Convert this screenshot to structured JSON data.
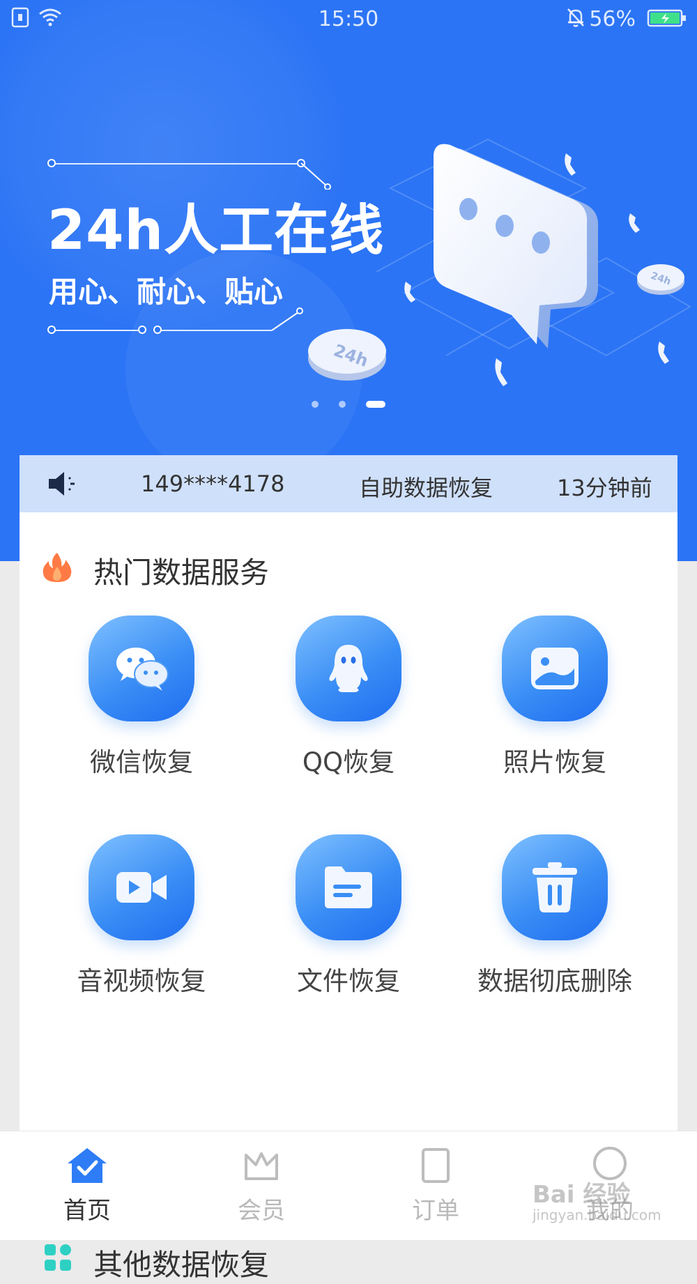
{
  "status_bar": {
    "time": "15:50",
    "battery_percent": "56%",
    "icons": [
      "sim-icon",
      "wifi-icon",
      "bell-off-icon",
      "battery-charging-icon"
    ]
  },
  "banner": {
    "title": "24h人工在线",
    "subtitle": "用心、耐心、贴心",
    "badge_text": "24h",
    "pages": 3,
    "active_page": 3
  },
  "ticker": {
    "phone": "149****4178",
    "action": "自助数据恢复",
    "time_ago": "13分钟前",
    "icon": "speaker-icon"
  },
  "hot_services": {
    "title": "热门数据服务",
    "icon": "flame-icon",
    "items": [
      {
        "label": "微信恢复",
        "icon": "wechat-icon"
      },
      {
        "label": "QQ恢复",
        "icon": "qq-penguin-icon"
      },
      {
        "label": "照片恢复",
        "icon": "photo-icon"
      },
      {
        "label": "音视频恢复",
        "icon": "video-camera-icon"
      },
      {
        "label": "文件恢复",
        "icon": "folder-icon"
      },
      {
        "label": "数据彻底删除",
        "icon": "trash-icon"
      }
    ]
  },
  "other_services": {
    "title": "其他数据恢复",
    "icon": "grid-icon"
  },
  "tabbar": {
    "items": [
      {
        "label": "首页",
        "icon": "home-check-icon",
        "active": true
      },
      {
        "label": "会员",
        "icon": "crown-icon",
        "active": false
      },
      {
        "label": "订单",
        "icon": "order-icon",
        "active": false
      },
      {
        "label": "我的",
        "icon": "profile-icon",
        "active": false
      }
    ]
  },
  "watermark": {
    "text": "Bai 经验",
    "url": "jingyan.baidu.com"
  },
  "colors": {
    "primary": "#2b74f5",
    "ticker_bg": "#cfe0fb",
    "active_tab_icon": "#2e7df6"
  }
}
